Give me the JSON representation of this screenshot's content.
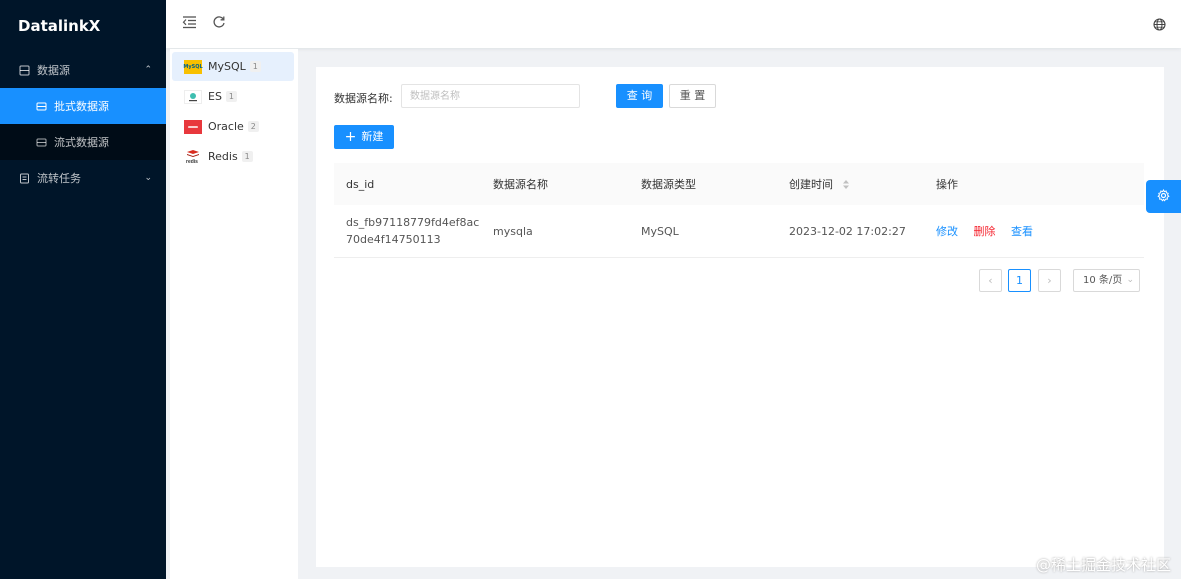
{
  "app": {
    "title": "DatalinkX"
  },
  "sidebar": {
    "groups": [
      {
        "label": "数据源",
        "expanded": true,
        "items": [
          {
            "label": "批式数据源",
            "active": true
          },
          {
            "label": "流式数据源",
            "active": false
          }
        ]
      },
      {
        "label": "流转任务",
        "expanded": false
      }
    ]
  },
  "datasource_types": [
    {
      "name": "MySQL",
      "count": "1",
      "logo": "mysql-logo"
    },
    {
      "name": "ES",
      "count": "1",
      "logo": "elasticsearch-logo"
    },
    {
      "name": "Oracle",
      "count": "2",
      "logo": "oracle-logo"
    },
    {
      "name": "Redis",
      "count": "1",
      "logo": "redis-logo"
    }
  ],
  "search": {
    "label": "数据源名称:",
    "placeholder": "数据源名称",
    "query_button": "查 询",
    "reset_button": "重 置"
  },
  "toolbar": {
    "new_button": "新建"
  },
  "table": {
    "columns": [
      "ds_id",
      "数据源名称",
      "数据源类型",
      "创建时间",
      "操作"
    ],
    "rows": [
      {
        "ds_id_line1": "ds_fb97118779fd4ef8ac",
        "ds_id_line2": "70de4f14750113",
        "name": "mysqla",
        "type": "MySQL",
        "created": "2023-12-02 17:02:27",
        "actions": {
          "edit": "修改",
          "delete": "删除",
          "view": "查看"
        }
      }
    ]
  },
  "pagination": {
    "current_page": "1",
    "page_size": "10 条/页",
    "prev": "‹",
    "next": "›"
  },
  "watermark": "@稀土掘金技术社区",
  "colors": {
    "primary": "#1890ff",
    "sidebar_bg": "#001529",
    "danger": "#f5222d"
  }
}
